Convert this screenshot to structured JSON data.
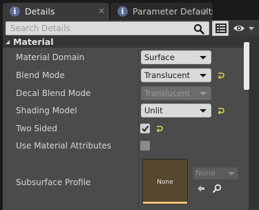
{
  "tabs": [
    {
      "label": "Details",
      "close": "✕"
    },
    {
      "label": "Parameter Defaults",
      "close": "✕"
    }
  ],
  "toolbar": {
    "search_placeholder": "Search Details",
    "search_value": ""
  },
  "category": {
    "title": "Material"
  },
  "properties": [
    {
      "label": "Material Domain",
      "value": "Surface"
    },
    {
      "label": "Blend Mode",
      "value": "Translucent"
    },
    {
      "label": "Decal Blend Mode",
      "value": "Translucent"
    },
    {
      "label": "Shading Model",
      "value": "Unlit"
    },
    {
      "label": "Two Sided",
      "checked": true
    },
    {
      "label": "Use Material Attributes",
      "checked": false
    },
    {
      "label": "Subsurface Profile",
      "thumbnail_label": "None",
      "value": "None"
    }
  ],
  "colors": {
    "panel_bg": "#4b4b4b",
    "reset_arrow": "#e2d34d",
    "thumbnail_accent": "#f3c47a"
  },
  "icons": [
    "info-icon",
    "close-icon",
    "search-icon",
    "grid-view-icon",
    "eye-icon",
    "chevron-down-icon",
    "reset-to-default-icon",
    "checkmark-icon",
    "use-selected-arrow-icon",
    "browse-magnifier-icon"
  ]
}
